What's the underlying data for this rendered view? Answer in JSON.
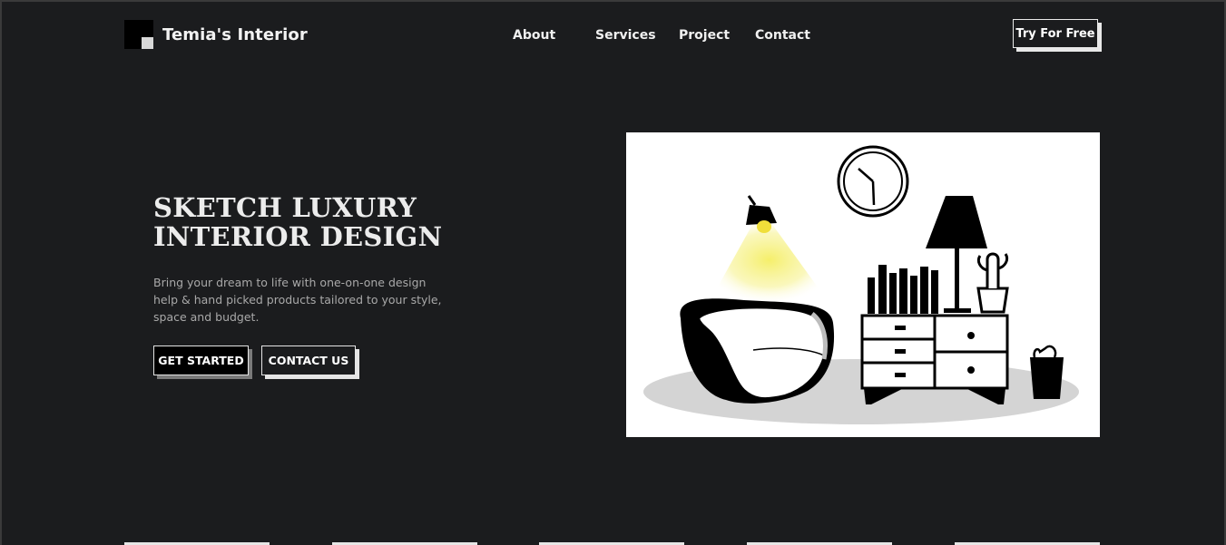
{
  "brand": {
    "name": "Temia's Interior"
  },
  "nav": {
    "items": [
      {
        "label": "About"
      },
      {
        "label": "Services"
      },
      {
        "label": "Project"
      },
      {
        "label": "Contact"
      }
    ],
    "cta_label": "Try For Free"
  },
  "hero": {
    "title_line1": "SKETCH LUXURY",
    "title_line2": "INTERIOR DESIGN",
    "subtitle": "Bring your dream to life with one-on-one design help & hand picked products tailored to your style, space and budget.",
    "primary_button": "GET STARTED",
    "secondary_button": "CONTACT US"
  },
  "illustration": {
    "icon": "living-room-illustration",
    "colors": {
      "lamp_light": "#f5ef6a",
      "rug": "#d4d4d4",
      "ink": "#000000"
    }
  },
  "colors": {
    "background": "#1b1c1e",
    "text": "#f0f0f0",
    "muted": "#a9a9a9",
    "accent": "#ffffff"
  }
}
